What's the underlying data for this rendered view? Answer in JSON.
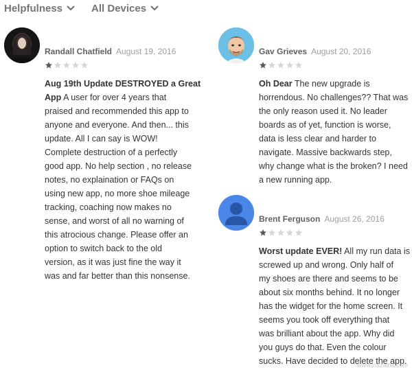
{
  "filters": [
    {
      "label": "Helpfulness"
    },
    {
      "label": "All Devices"
    }
  ],
  "reviews": [
    {
      "author": "Randall Chatfield",
      "date": "August 19, 2016",
      "rating": 1,
      "title": "Aug 19th Update DESTROYED a Great",
      "title_cont": "App",
      "lines": [
        " A user for over 4 years that",
        "praised and recommended this app to",
        "anyone and everyone. And then... this",
        "update. All I can say is WOW!",
        "Complete destruction of a perfectly",
        "good app. No help section , no release",
        "notes, no explaination or FAQs on",
        "using new app, no more shoe mileage",
        "tracking, coaching now makes no",
        "sense, and worst of all no warning of",
        "this atrocious change. Please offer an",
        "option to switch back to the old",
        "version, as it was just fine the way it",
        "was and far better than this nonsense."
      ],
      "avatar": "photo-avatar"
    },
    {
      "author": "Gav Grieves",
      "date": "August 20, 2016",
      "rating": 1,
      "title": "Oh Dear",
      "lines": [
        " The new upgrade is",
        "horrendous. No challenges?? That was",
        "the only reason used it. No leader",
        "boards as of yet, function is worse,",
        "data is less clear and harder to",
        "navigate. Massive backwards step,",
        "why change what is the broken? I need",
        "a new running app."
      ],
      "avatar": "cartoon-avatar"
    },
    {
      "author": "Brent Ferguson",
      "date": "August 26, 2016",
      "rating": 1,
      "title": "Worst update EVER!",
      "lines": [
        " All my run data is",
        "screwed up and wrong. Only half of",
        "my shoes are there and seems to be",
        "about six months behind. It no longer",
        "has the widget for the home screen. It",
        "seems you took off everything that",
        "was brilliant about the app. Why did",
        "you guys do that. Even the colour",
        "sucks. Have decided to delete the app."
      ],
      "avatar": "default-person-avatar"
    }
  ],
  "watermark": "www.xiazaiba.com",
  "colors": {
    "star_filled": "#5a5a5a",
    "star_empty": "#d6d6d6",
    "default_avatar_bg": "#4a86e8"
  }
}
